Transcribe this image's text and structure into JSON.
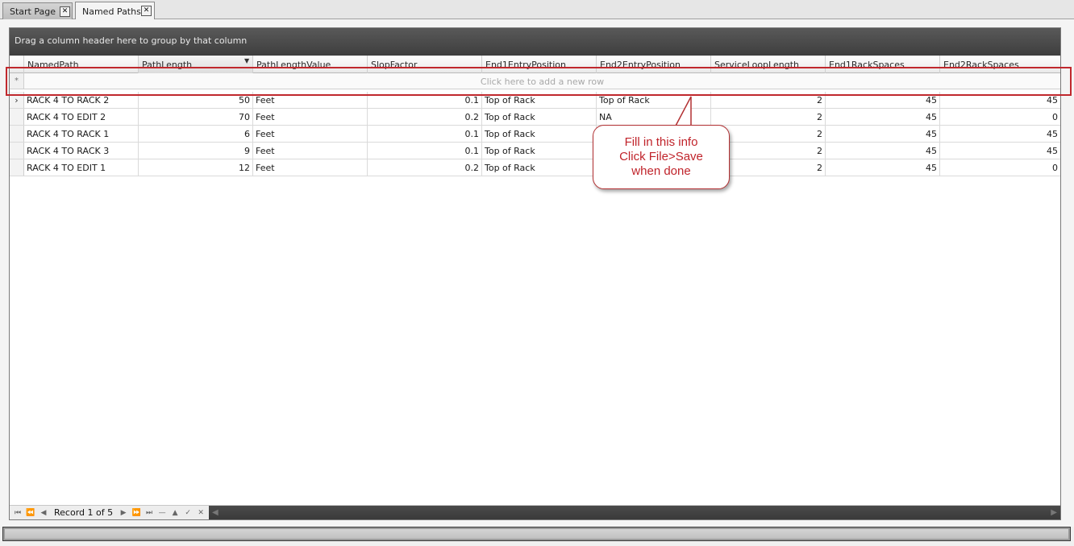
{
  "tabs": [
    {
      "label": "Start Page",
      "active": false
    },
    {
      "label": "Named Paths",
      "active": true
    }
  ],
  "grid": {
    "group_panel_text": "Drag a column header here to group by that column",
    "columns": [
      "NamedPath",
      "PathLength",
      "PathLengthValue",
      "SlopFactor",
      "End1EntryPosition",
      "End2EntryPosition",
      "ServiceLoopLength",
      "End1RackSpaces",
      "End2RackSpaces"
    ],
    "new_row_text": "Click here to add a new row",
    "new_row_symbol": "*",
    "row_indicator_symbol": "›",
    "rows": [
      [
        "RACK 4 TO RACK 2",
        "50",
        "Feet",
        "0.1",
        "Top of Rack",
        "Top of Rack",
        "2",
        "45",
        "45"
      ],
      [
        "RACK 4 TO EDIT 2",
        "70",
        "Feet",
        "0.2",
        "Top of Rack",
        "NA",
        "2",
        "45",
        "0"
      ],
      [
        "RACK 4 TO RACK 1",
        "6",
        "Feet",
        "0.1",
        "Top of Rack",
        "",
        "2",
        "45",
        "45"
      ],
      [
        "RACK 4 TO RACK 3",
        "9",
        "Feet",
        "0.1",
        "Top of Rack",
        "",
        "2",
        "45",
        "45"
      ],
      [
        "RACK 4 TO EDIT 1",
        "12",
        "Feet",
        "0.2",
        "Top of Rack",
        "",
        "2",
        "45",
        "0"
      ]
    ]
  },
  "navigator": {
    "record_label": "Record 1 of 5"
  },
  "annotation": {
    "line1": "Fill in this info",
    "line2": "Click File>Save",
    "line3": "when done",
    "color": "#c0232a"
  }
}
